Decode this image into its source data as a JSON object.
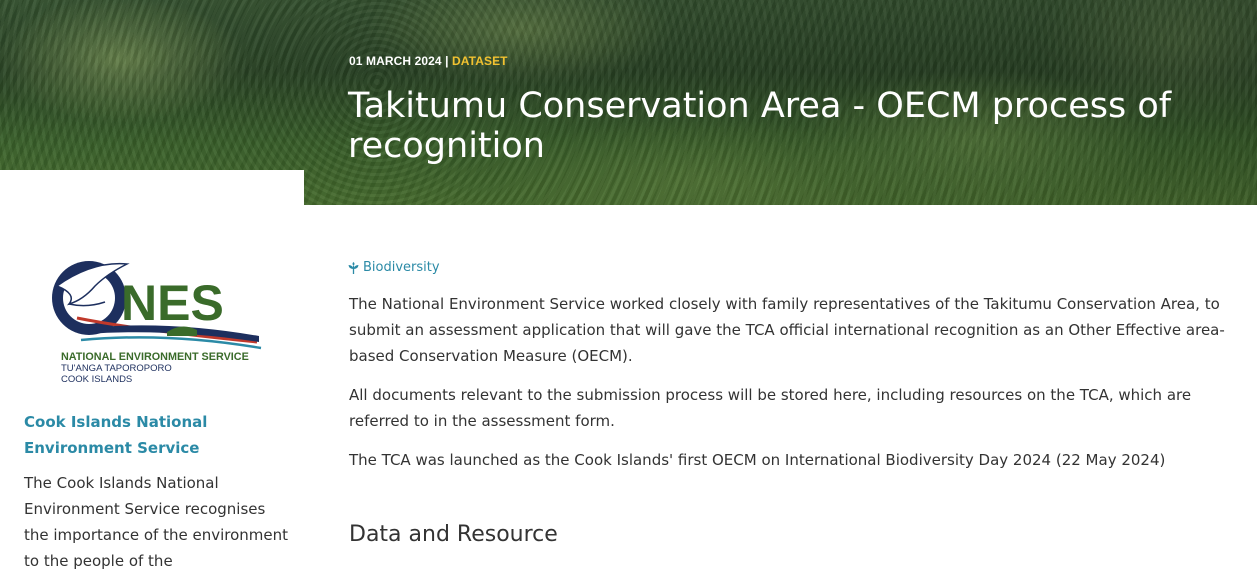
{
  "hero": {
    "date": "01 MARCH 2024",
    "separator": "|",
    "type": "DATASET",
    "title": "Takitumu Conservation Area - OECM process of recognition"
  },
  "sidebar": {
    "logo": {
      "acronym": "NES",
      "line1": "NATIONAL ENVIRONMENT SERVICE",
      "line2": "TU'ANGA TAPOROPORO",
      "line3": "COOK ISLANDS"
    },
    "org_name": "Cook Islands National Environment Service",
    "org_description": "The Cook Islands National Environment Service recognises the importance of the environment to the people of the"
  },
  "main": {
    "tag": {
      "label": "Biodiversity",
      "icon": "leaf-icon"
    },
    "paragraphs": [
      "The National Environment Service worked closely with family representatives of the Takitumu Conservation Area, to submit an assessment application that will gave the TCA official international recognition as an Other Effective area-based Conservation Measure (OECM).",
      "All documents relevant to the submission process will be stored here, including resources on the TCA, which are referred to in the assessment form.",
      "The TCA was launched as the Cook Islands' first OECM on International Biodiversity Day 2024 (22 May 2024)"
    ],
    "section_heading": "Data and Resource"
  },
  "colors": {
    "accent_link": "#2b8aa6",
    "dataset_label": "#f2c230",
    "logo_green": "#3a6b2a",
    "logo_navy": "#1d2f5e",
    "logo_red": "#c0392b"
  }
}
